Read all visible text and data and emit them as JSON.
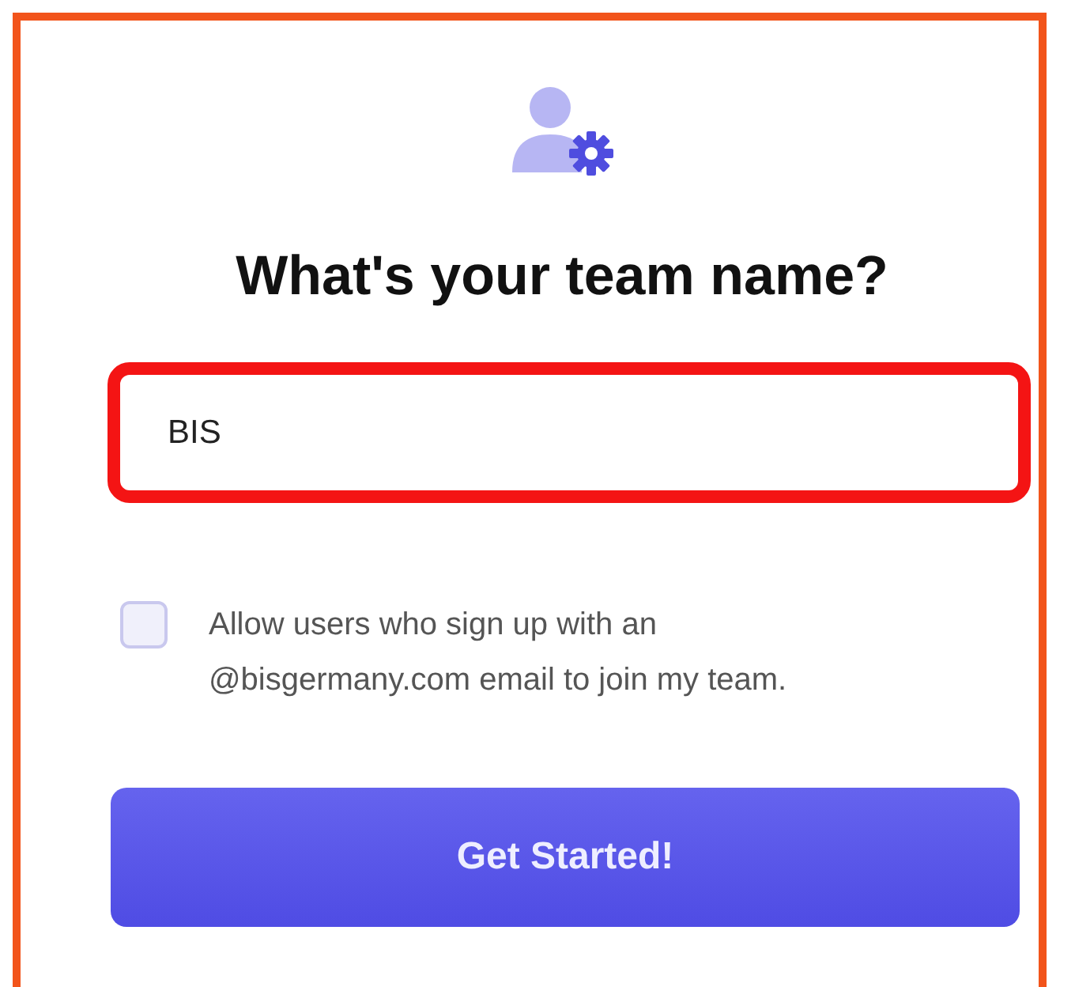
{
  "heading": "What's your team name?",
  "team_name": {
    "value": "BIS"
  },
  "allow_domain": {
    "label": "Allow users who sign up with an @bisgermany.com email to join my team.",
    "checked": false
  },
  "buttons": [
    "Get Started!"
  ]
}
